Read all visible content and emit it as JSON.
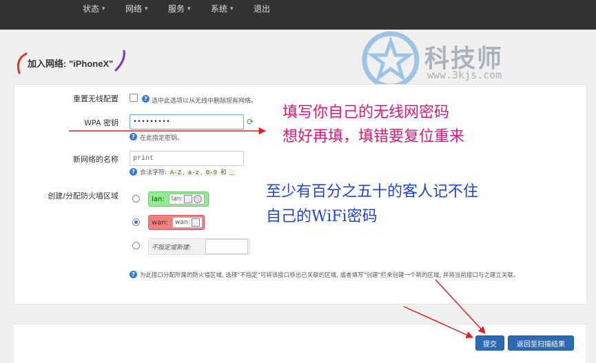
{
  "nav": {
    "menus": [
      "状态",
      "网络",
      "服务",
      "系统"
    ],
    "logout": "退出"
  },
  "page": {
    "title": "加入网络: \"iPhoneX\""
  },
  "watermark": {
    "brand": "科技师",
    "url": "www.3kjs.com"
  },
  "form": {
    "reset_wireless": {
      "label": "重置无线配置",
      "help": "选中此选项以从无线中删除现有网络。"
    },
    "wpa_key": {
      "label": "WPA 密钥",
      "value": "•••••••••",
      "help": "在此指定密钥。"
    },
    "network_name": {
      "label": "新网络的名称",
      "value": "print",
      "help_prefix": "合法字符:",
      "help_codes": [
        "A-Z",
        "a-z",
        "0-9"
      ],
      "help_and": "和",
      "help_underscore": "_"
    },
    "firewall_zone": {
      "label": "创建/分配防火墙区域",
      "zones": [
        {
          "name": "lan:",
          "net": "lan:",
          "color": "#90ee90"
        },
        {
          "name": "wan:",
          "net": "wan:",
          "color": "#f08080"
        }
      ],
      "unspecified_label": "不指定或新建:",
      "selected": "wan",
      "help": "为此接口分配所属的防火墙区域, 选择\"不指定\"可将该接口移出已关联的区域, 或者填写\"创建\"栏来创建一个新的区域, 并将当前接口与之建立关联。"
    }
  },
  "buttons": {
    "submit": "提交",
    "back": "返回至扫描结果"
  },
  "annotations": {
    "line1": "填写你自己的无线网密码",
    "line2": "想好再填，填错要复位重来",
    "line3": "至少有百分之五十的客人记不住",
    "line4": "自己的WiFi密码",
    "pink": "#e0187a",
    "blue": "#2244cc",
    "arrow": "#e02020"
  }
}
